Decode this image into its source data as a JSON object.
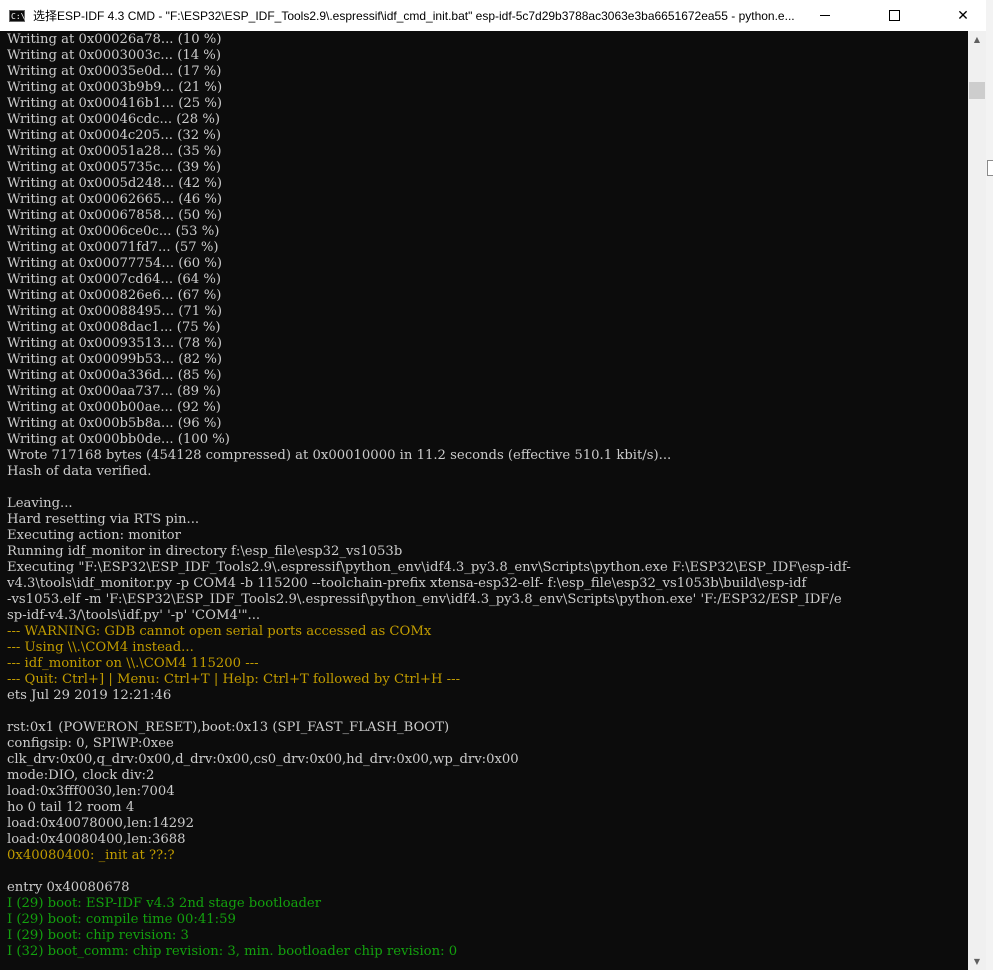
{
  "window": {
    "title": "选择ESP-IDF 4.3 CMD - \"F:\\ESP32\\ESP_IDF_Tools2.9\\.espressif\\idf_cmd_init.bat\"  esp-idf-5c7d29b3788ac3063e3ba6651672ea55 - python.e...",
    "icon": "console-icon",
    "icon_text": "C:\\",
    "controls": {
      "minimize": "minimize-icon",
      "maximize": "maximize-icon",
      "close": "✕"
    }
  },
  "colors": {
    "background": "#0c0c0c",
    "text": "#cccccc",
    "warning": "#c19c00",
    "info": "#13a10e"
  },
  "scrollbar": {
    "up": "▲",
    "down": "▼"
  },
  "console_lines": [
    {
      "text": "Writing at 0x00026a78... (10 %)",
      "style": "normal"
    },
    {
      "text": "Writing at 0x0003003c... (14 %)",
      "style": "normal"
    },
    {
      "text": "Writing at 0x00035e0d... (17 %)",
      "style": "normal"
    },
    {
      "text": "Writing at 0x0003b9b9... (21 %)",
      "style": "normal"
    },
    {
      "text": "Writing at 0x000416b1... (25 %)",
      "style": "normal"
    },
    {
      "text": "Writing at 0x00046cdc... (28 %)",
      "style": "normal"
    },
    {
      "text": "Writing at 0x0004c205... (32 %)",
      "style": "normal"
    },
    {
      "text": "Writing at 0x00051a28... (35 %)",
      "style": "normal"
    },
    {
      "text": "Writing at 0x0005735c... (39 %)",
      "style": "normal"
    },
    {
      "text": "Writing at 0x0005d248... (42 %)",
      "style": "normal"
    },
    {
      "text": "Writing at 0x00062665... (46 %)",
      "style": "normal"
    },
    {
      "text": "Writing at 0x00067858... (50 %)",
      "style": "normal"
    },
    {
      "text": "Writing at 0x0006ce0c... (53 %)",
      "style": "normal"
    },
    {
      "text": "Writing at 0x00071fd7... (57 %)",
      "style": "normal"
    },
    {
      "text": "Writing at 0x00077754... (60 %)",
      "style": "normal"
    },
    {
      "text": "Writing at 0x0007cd64... (64 %)",
      "style": "normal"
    },
    {
      "text": "Writing at 0x000826e6... (67 %)",
      "style": "normal"
    },
    {
      "text": "Writing at 0x00088495... (71 %)",
      "style": "normal"
    },
    {
      "text": "Writing at 0x0008dac1... (75 %)",
      "style": "normal"
    },
    {
      "text": "Writing at 0x00093513... (78 %)",
      "style": "normal"
    },
    {
      "text": "Writing at 0x00099b53... (82 %)",
      "style": "normal"
    },
    {
      "text": "Writing at 0x000a336d... (85 %)",
      "style": "normal"
    },
    {
      "text": "Writing at 0x000aa737... (89 %)",
      "style": "normal"
    },
    {
      "text": "Writing at 0x000b00ae... (92 %)",
      "style": "normal"
    },
    {
      "text": "Writing at 0x000b5b8a... (96 %)",
      "style": "normal"
    },
    {
      "text": "Writing at 0x000bb0de... (100 %)",
      "style": "normal"
    },
    {
      "text": "Wrote 717168 bytes (454128 compressed) at 0x00010000 in 11.2 seconds (effective 510.1 kbit/s)...",
      "style": "normal"
    },
    {
      "text": "Hash of data verified.",
      "style": "normal"
    },
    {
      "text": "",
      "style": "normal"
    },
    {
      "text": "Leaving...",
      "style": "normal"
    },
    {
      "text": "Hard resetting via RTS pin...",
      "style": "normal"
    },
    {
      "text": "Executing action: monitor",
      "style": "normal"
    },
    {
      "text": "Running idf_monitor in directory f:\\esp_file\\esp32_vs1053b",
      "style": "normal"
    },
    {
      "text": "Executing \"F:\\ESP32\\ESP_IDF_Tools2.9\\.espressif\\python_env\\idf4.3_py3.8_env\\Scripts\\python.exe F:\\ESP32\\ESP_IDF\\esp-idf-",
      "style": "normal"
    },
    {
      "text": "v4.3\\tools\\idf_monitor.py -p COM4 -b 115200 --toolchain-prefix xtensa-esp32-elf- f:\\esp_file\\esp32_vs1053b\\build\\esp-idf",
      "style": "normal"
    },
    {
      "text": "-vs1053.elf -m 'F:\\ESP32\\ESP_IDF_Tools2.9\\.espressif\\python_env\\idf4.3_py3.8_env\\Scripts\\python.exe' 'F:/ESP32/ESP_IDF/e",
      "style": "normal"
    },
    {
      "text": "sp-idf-v4.3/\\tools\\idf.py' '-p' 'COM4'\"...",
      "style": "normal"
    },
    {
      "text": "--- WARNING: GDB cannot open serial ports accessed as COMx",
      "style": "warning"
    },
    {
      "text": "--- Using \\\\.\\COM4 instead...",
      "style": "warning"
    },
    {
      "text": "--- idf_monitor on \\\\.\\COM4 115200 ---",
      "style": "warning"
    },
    {
      "text": "--- Quit: Ctrl+] | Menu: Ctrl+T | Help: Ctrl+T followed by Ctrl+H ---",
      "style": "warning"
    },
    {
      "text": "ets Jul 29 2019 12:21:46",
      "style": "normal"
    },
    {
      "text": "",
      "style": "normal"
    },
    {
      "text": "rst:0x1 (POWERON_RESET),boot:0x13 (SPI_FAST_FLASH_BOOT)",
      "style": "normal"
    },
    {
      "text": "configsip: 0, SPIWP:0xee",
      "style": "normal"
    },
    {
      "text": "clk_drv:0x00,q_drv:0x00,d_drv:0x00,cs0_drv:0x00,hd_drv:0x00,wp_drv:0x00",
      "style": "normal"
    },
    {
      "text": "mode:DIO, clock div:2",
      "style": "normal"
    },
    {
      "text": "load:0x3fff0030,len:7004",
      "style": "normal"
    },
    {
      "text": "ho 0 tail 12 room 4",
      "style": "normal"
    },
    {
      "text": "load:0x40078000,len:14292",
      "style": "normal"
    },
    {
      "text": "load:0x40080400,len:3688",
      "style": "normal"
    },
    {
      "text": "0x40080400: _init at ??:?",
      "style": "warning"
    },
    {
      "text": "",
      "style": "normal"
    },
    {
      "text": "entry 0x40080678",
      "style": "normal"
    },
    {
      "text": "I (29) boot: ESP-IDF v4.3 2nd stage bootloader",
      "style": "info"
    },
    {
      "text": "I (29) boot: compile time 00:41:59",
      "style": "info"
    },
    {
      "text": "I (29) boot: chip revision: 3",
      "style": "info"
    },
    {
      "text": "I (32) boot_comm: chip revision: 3, min. bootloader chip revision: 0",
      "style": "info"
    }
  ]
}
